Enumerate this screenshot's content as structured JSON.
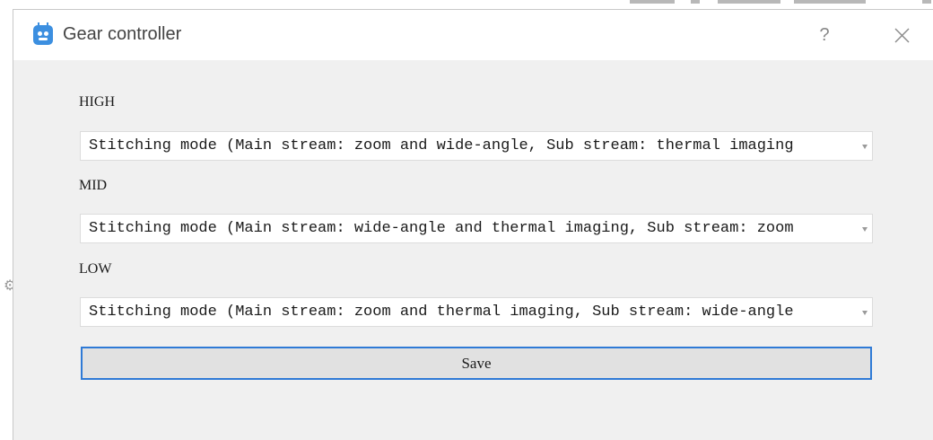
{
  "window": {
    "title": "Gear controller",
    "help_label": "?"
  },
  "gears": [
    {
      "label": "HIGH",
      "selected": "Stitching mode (Main stream: zoom and wide-angle, Sub stream: thermal imaging"
    },
    {
      "label": "MID",
      "selected": "Stitching mode (Main stream: wide-angle and thermal imaging, Sub stream: zoom"
    },
    {
      "label": "LOW",
      "selected": "Stitching mode (Main stream: zoom and thermal imaging, Sub stream: wide-angle"
    }
  ],
  "save_label": "Save",
  "colors": {
    "accent": "#2f7ad6",
    "app_icon": "#3c8fe0",
    "dialog_bg": "#f0f0f0"
  },
  "icons": {
    "app": "robot-face-icon",
    "close": "close-icon",
    "help": "help-icon",
    "dropdown": "chevron-down-icon"
  }
}
